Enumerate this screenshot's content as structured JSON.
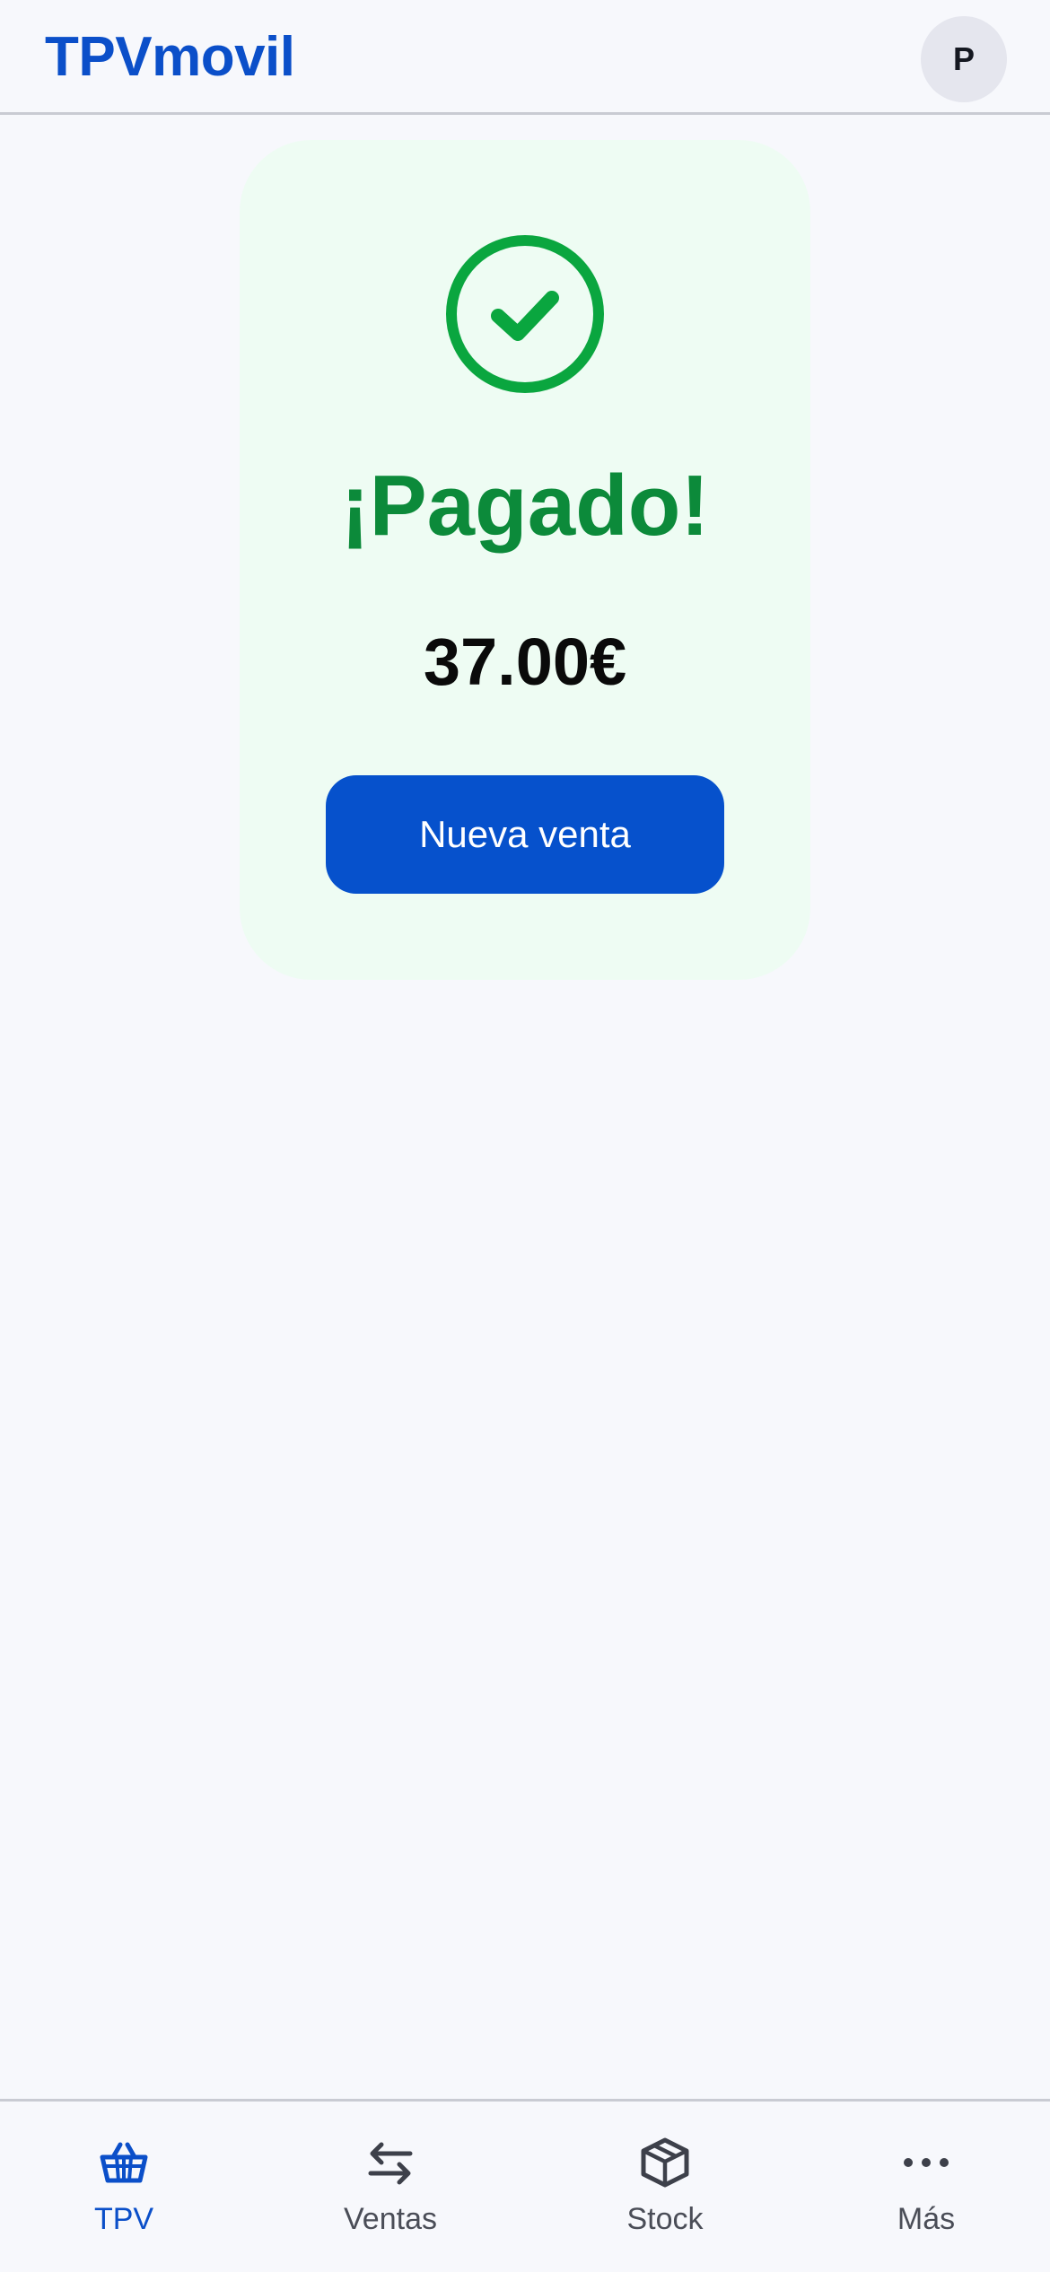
{
  "header": {
    "brand": "TPVmovil",
    "avatar_initial": "P"
  },
  "confirmation": {
    "icon": "check-circle-icon",
    "title": "¡Pagado!",
    "amount": "37.00€",
    "button_label": "Nueva venta"
  },
  "bottom_nav": {
    "items": [
      {
        "label": "TPV",
        "icon": "basket-icon",
        "active": true
      },
      {
        "label": "Ventas",
        "icon": "swap-arrows-icon",
        "active": false
      },
      {
        "label": "Stock",
        "icon": "box-icon",
        "active": false
      },
      {
        "label": "Más",
        "icon": "more-dots-icon",
        "active": false
      }
    ]
  },
  "colors": {
    "brand": "#0b4fc9",
    "success": "#0c8a3a",
    "success_icon": "#0aa63f",
    "card_bg": "#eefcf3",
    "button_bg": "#0651cc",
    "page_bg": "#f7f8fc"
  }
}
